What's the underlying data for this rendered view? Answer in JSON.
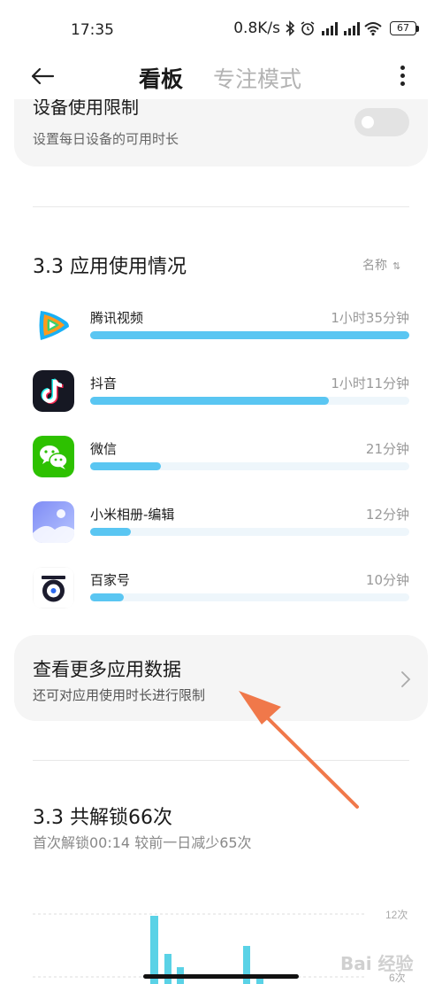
{
  "status_bar": {
    "time": "17:35",
    "net_speed": "0.8K/s",
    "icons": [
      "bluetooth-icon",
      "alarm-icon",
      "signal-hd-icon",
      "signal-hd-icon",
      "wifi-icon"
    ],
    "battery": "67"
  },
  "header": {
    "tabs": [
      {
        "label": "看板",
        "active": true
      },
      {
        "label": "专注模式",
        "active": false
      }
    ],
    "back_icon": "arrow-left-icon",
    "menu_icon": "more-vertical-icon"
  },
  "device_limit": {
    "title": "设备使用限制",
    "subtitle": "设置每日设备的可用时长",
    "enabled": false
  },
  "app_usage": {
    "title": "3.3 应用使用情况",
    "sort_label": "名称",
    "sort_icon": "sort-icon",
    "apps": [
      {
        "name": "腾讯视频",
        "time": "1小时35分钟",
        "minutes": 95,
        "icon": "tencent-video-icon"
      },
      {
        "name": "抖音",
        "time": "1小时11分钟",
        "minutes": 71,
        "icon": "douyin-icon"
      },
      {
        "name": "微信",
        "time": "21分钟",
        "minutes": 21,
        "icon": "wechat-icon"
      },
      {
        "name": "小米相册-编辑",
        "time": "12分钟",
        "minutes": 12,
        "icon": "gallery-editor-icon"
      },
      {
        "name": "百家号",
        "time": "10分钟",
        "minutes": 10,
        "icon": "baijiahao-icon"
      }
    ],
    "bar_color": "#5ac6f2"
  },
  "more_data": {
    "title": "查看更多应用数据",
    "subtitle": "还可对应用使用时长进行限制",
    "chevron_icon": "chevron-right-icon"
  },
  "unlock": {
    "title": "3.3 共解锁66次",
    "subtitle": "首次解锁00:14   较前一日减少65次",
    "axis_labels": [
      "12次",
      "6次"
    ],
    "bar_color": "#5ad2e6"
  },
  "annotation": {
    "arrow_color": "#f0784a"
  },
  "watermark": {
    "text": "Bai 经验"
  }
}
